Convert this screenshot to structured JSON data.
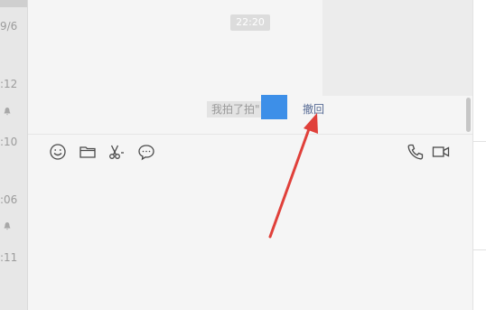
{
  "chat_list": {
    "timestamps": [
      "9/6",
      ":12",
      ":10",
      ":06",
      ":11"
    ]
  },
  "chat": {
    "time_pill": "22:20",
    "system_message": "我拍了拍\"",
    "recall_label": "撤回"
  },
  "toolbar": {
    "icons": [
      "emoji-icon",
      "folder-icon",
      "scissors-icon",
      "chat-bubble-icon",
      "phone-icon",
      "video-icon"
    ]
  },
  "colors": {
    "avatar": "#3d8fe8",
    "recall_link": "#576b95",
    "arrow": "#e0403a"
  }
}
